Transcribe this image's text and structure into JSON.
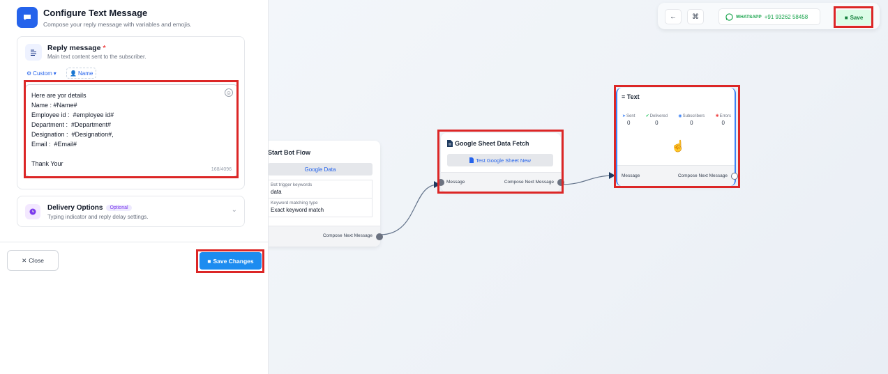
{
  "panel": {
    "title": "Configure Text Message",
    "subtitle": "Compose your reply message with variables and emojis.",
    "reply": {
      "title": "Reply message",
      "required_mark": "*",
      "subtitle": "Main text content sent to the subscriber.",
      "custom_label": "Custom",
      "name_label": "Name",
      "lines": [
        "Here are yor details",
        "Name : #Name#",
        "Employee id :  #employee id#",
        "Department :  #Department#",
        "Designation :  #Designation#,",
        "Email :  #Email#",
        "",
        "Thank Your"
      ],
      "counter": "168/4096"
    },
    "delivery": {
      "title": "Delivery Options",
      "badge": "Optional",
      "subtitle": "Typing indicator and reply delay settings."
    },
    "close_label": "Close",
    "save_changes_label": "Save Changes"
  },
  "toolbar": {
    "whatsapp_label": "WHATSAPP",
    "phone": "+91 93262 58458",
    "save_label": "Save"
  },
  "nodes": {
    "start": {
      "title": "Start Bot Flow",
      "button": "Google Data",
      "rows": [
        {
          "key": "Bot trigger keywords",
          "value": "data"
        },
        {
          "key": "Keyword matching type",
          "value": "Exact keyword match"
        }
      ],
      "output_label": "Compose Next Message"
    },
    "google_sheet": {
      "title": "Google Sheet Data Fetch",
      "button": "Test Google Sheet New",
      "input_label": "Message",
      "output_label": "Compose Next Message"
    },
    "text": {
      "title": "Text",
      "stats": [
        {
          "label": "Sent",
          "value": "0",
          "color": "#3b82f6"
        },
        {
          "label": "Delivered",
          "value": "0",
          "color": "#22c55e"
        },
        {
          "label": "Subscribers",
          "value": "0",
          "color": "#3b82f6"
        },
        {
          "label": "Errors",
          "value": "0",
          "color": "#ef4444"
        }
      ],
      "input_label": "Message",
      "output_label": "Compose Next Message"
    }
  },
  "colors": {
    "accent": "#2563eb",
    "highlight": "#dc2626",
    "save_bg": "#dcfce7",
    "whatsapp": "#16a34a"
  }
}
